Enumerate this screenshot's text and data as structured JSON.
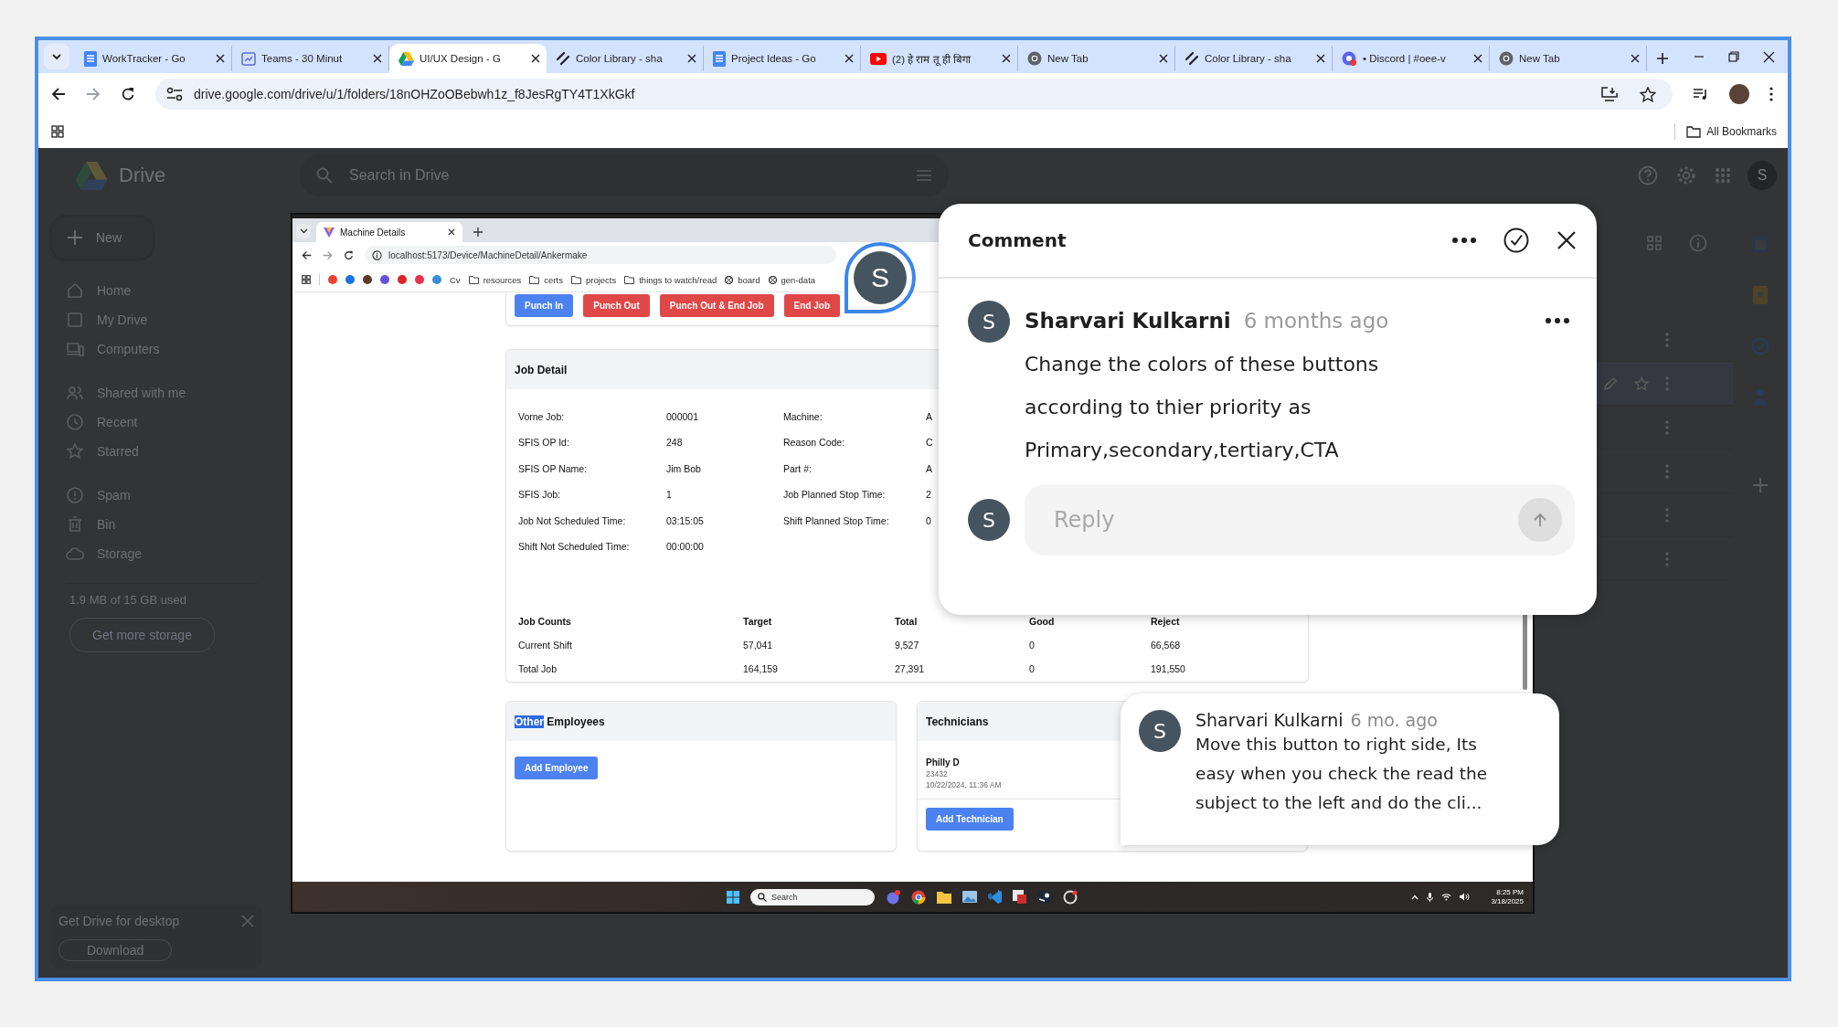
{
  "browser": {
    "tabs": [
      {
        "title": "WorkTracker - Go",
        "kind": "doc",
        "selected": false
      },
      {
        "title": "Teams - 30 Minut",
        "kind": "calendar",
        "selected": false
      },
      {
        "title": "UI/UX Design - G",
        "kind": "drive",
        "selected": true
      },
      {
        "title": "Color Library - sha",
        "kind": "pen",
        "selected": false
      },
      {
        "title": "Project Ideas - Go",
        "kind": "doc",
        "selected": false
      },
      {
        "title": "(2) हे राम तू ही बिगा",
        "kind": "video",
        "selected": false
      },
      {
        "title": "New Tab",
        "kind": "globe",
        "selected": false
      },
      {
        "title": "Color Library - sha",
        "kind": "pen",
        "selected": false
      },
      {
        "title": "• Discord | #oee-v",
        "kind": "chat",
        "selected": false
      },
      {
        "title": "New Tab",
        "kind": "globe",
        "selected": false
      }
    ],
    "address": "drive.google.com/drive/u/1/folders/18nOHZoOBebwh1z_f8JesRgTY4T1XkGkf",
    "bookmarks_label": "All Bookmarks"
  },
  "drive": {
    "logo_text": "Drive",
    "search_placeholder": "Search in Drive",
    "avatar_initial": "S",
    "new_button": "New",
    "nav_groups": [
      [
        {
          "label": "Home",
          "kind": "home"
        },
        {
          "label": "My Drive",
          "kind": "drive"
        },
        {
          "label": "Computers",
          "kind": "computer"
        }
      ],
      [
        {
          "label": "Shared with me",
          "kind": "people"
        },
        {
          "label": "Recent",
          "kind": "clock"
        },
        {
          "label": "Starred",
          "kind": "star"
        }
      ],
      [
        {
          "label": "Spam",
          "kind": "alert"
        },
        {
          "label": "Bin",
          "kind": "bin"
        },
        {
          "label": "Storage",
          "kind": "cloud"
        }
      ]
    ],
    "storage_text": "1.9 MB of 15 GB used",
    "storage_button": "Get more storage",
    "desktop_promo": {
      "title": "Get Drive for desktop",
      "button": "Download"
    }
  },
  "preview": {
    "tab_title": "Machine Details",
    "url": "localhost:5173/Device/MachineDetail/Ankermake",
    "bookmarks": [
      {
        "kind": "icon",
        "color": "#ea4335"
      },
      {
        "kind": "icon",
        "color": "#1a73e8"
      },
      {
        "kind": "icon",
        "color": "#5f3a2a"
      },
      {
        "kind": "icon",
        "color": "#6a4fe0"
      },
      {
        "kind": "icon",
        "color": "#e02424"
      },
      {
        "kind": "icon",
        "color": "#e8334a"
      },
      {
        "kind": "icon",
        "color": "#3a8fd8"
      },
      {
        "kind": "text",
        "label": "Cv"
      },
      {
        "kind": "folder",
        "label": "resources"
      },
      {
        "kind": "folder",
        "label": "certs"
      },
      {
        "kind": "folder",
        "label": "projects"
      },
      {
        "kind": "folder",
        "label": "things to watch/read"
      },
      {
        "kind": "site",
        "label": "board"
      },
      {
        "kind": "site",
        "label": "gen-data"
      }
    ],
    "actions": [
      {
        "label": "Punch In",
        "kind": "primary"
      },
      {
        "label": "Punch Out",
        "kind": "danger"
      },
      {
        "label": "Punch Out & End Job",
        "kind": "danger"
      },
      {
        "label": "End Job",
        "kind": "danger"
      }
    ],
    "job_detail": {
      "title": "Job Detail",
      "fields": [
        {
          "label": "Vorne Job:",
          "value": "000001",
          "label2": "Machine:",
          "value2": "A"
        },
        {
          "label": "SFIS OP Id:",
          "value": "248",
          "label2": "Reason Code:",
          "value2": "C"
        },
        {
          "label": "SFIS OP Name:",
          "value": "Jim Bob",
          "label2": "Part #:",
          "value2": "A"
        },
        {
          "label": "SFIS Job:",
          "value": "1",
          "label2": "Job Planned Stop Time:",
          "value2": "2"
        },
        {
          "label": "Job Not Scheduled Time:",
          "value": "03:15:05",
          "label2": "Shift Planned Stop Time:",
          "value2": "0"
        },
        {
          "label": "Shift Not Scheduled Time:",
          "value": "00:00:00"
        }
      ]
    },
    "job_counts": {
      "columns": [
        "Job Counts",
        "Target",
        "Total",
        "Good",
        "Reject"
      ],
      "rows": [
        [
          "Current Shift",
          "57,041",
          "9,527",
          "0",
          "66,568"
        ],
        [
          "Total Job",
          "164,159",
          "27,391",
          "0",
          "191,550"
        ]
      ]
    },
    "employees": {
      "title_parts": [
        {
          "text": "Other",
          "selected": true
        },
        {
          "text": " Employees",
          "selected": false
        }
      ],
      "button": "Add Employee"
    },
    "technicians": {
      "title": "Technicians",
      "name": "Philly D",
      "id": "23432",
      "date": "10/22/2024, 11:36 AM",
      "button": "Add Technician"
    },
    "taskbar": {
      "search_placeholder": "Search",
      "time": "8:25 PM",
      "date": "3/18/2025"
    }
  },
  "marker": {
    "initial": "S"
  },
  "comment_panel": {
    "title": "Comment",
    "initial": "S",
    "author": "Sharvari Kulkarni",
    "time": "6 months ago",
    "text": "Change the colors of these buttons\naccording to thier priority as\nPrimary,secondary,tertiary,CTA",
    "reply_initial": "S",
    "reply_placeholder": "Reply",
    "send_disabled": true
  },
  "comment_bubble": {
    "initial": "S",
    "author": "Sharvari Kulkarni",
    "time": "6 mo. ago",
    "text": "Move this button to right side, Its\neasy when you check the read the\nsubject to the left and do the cli..."
  }
}
